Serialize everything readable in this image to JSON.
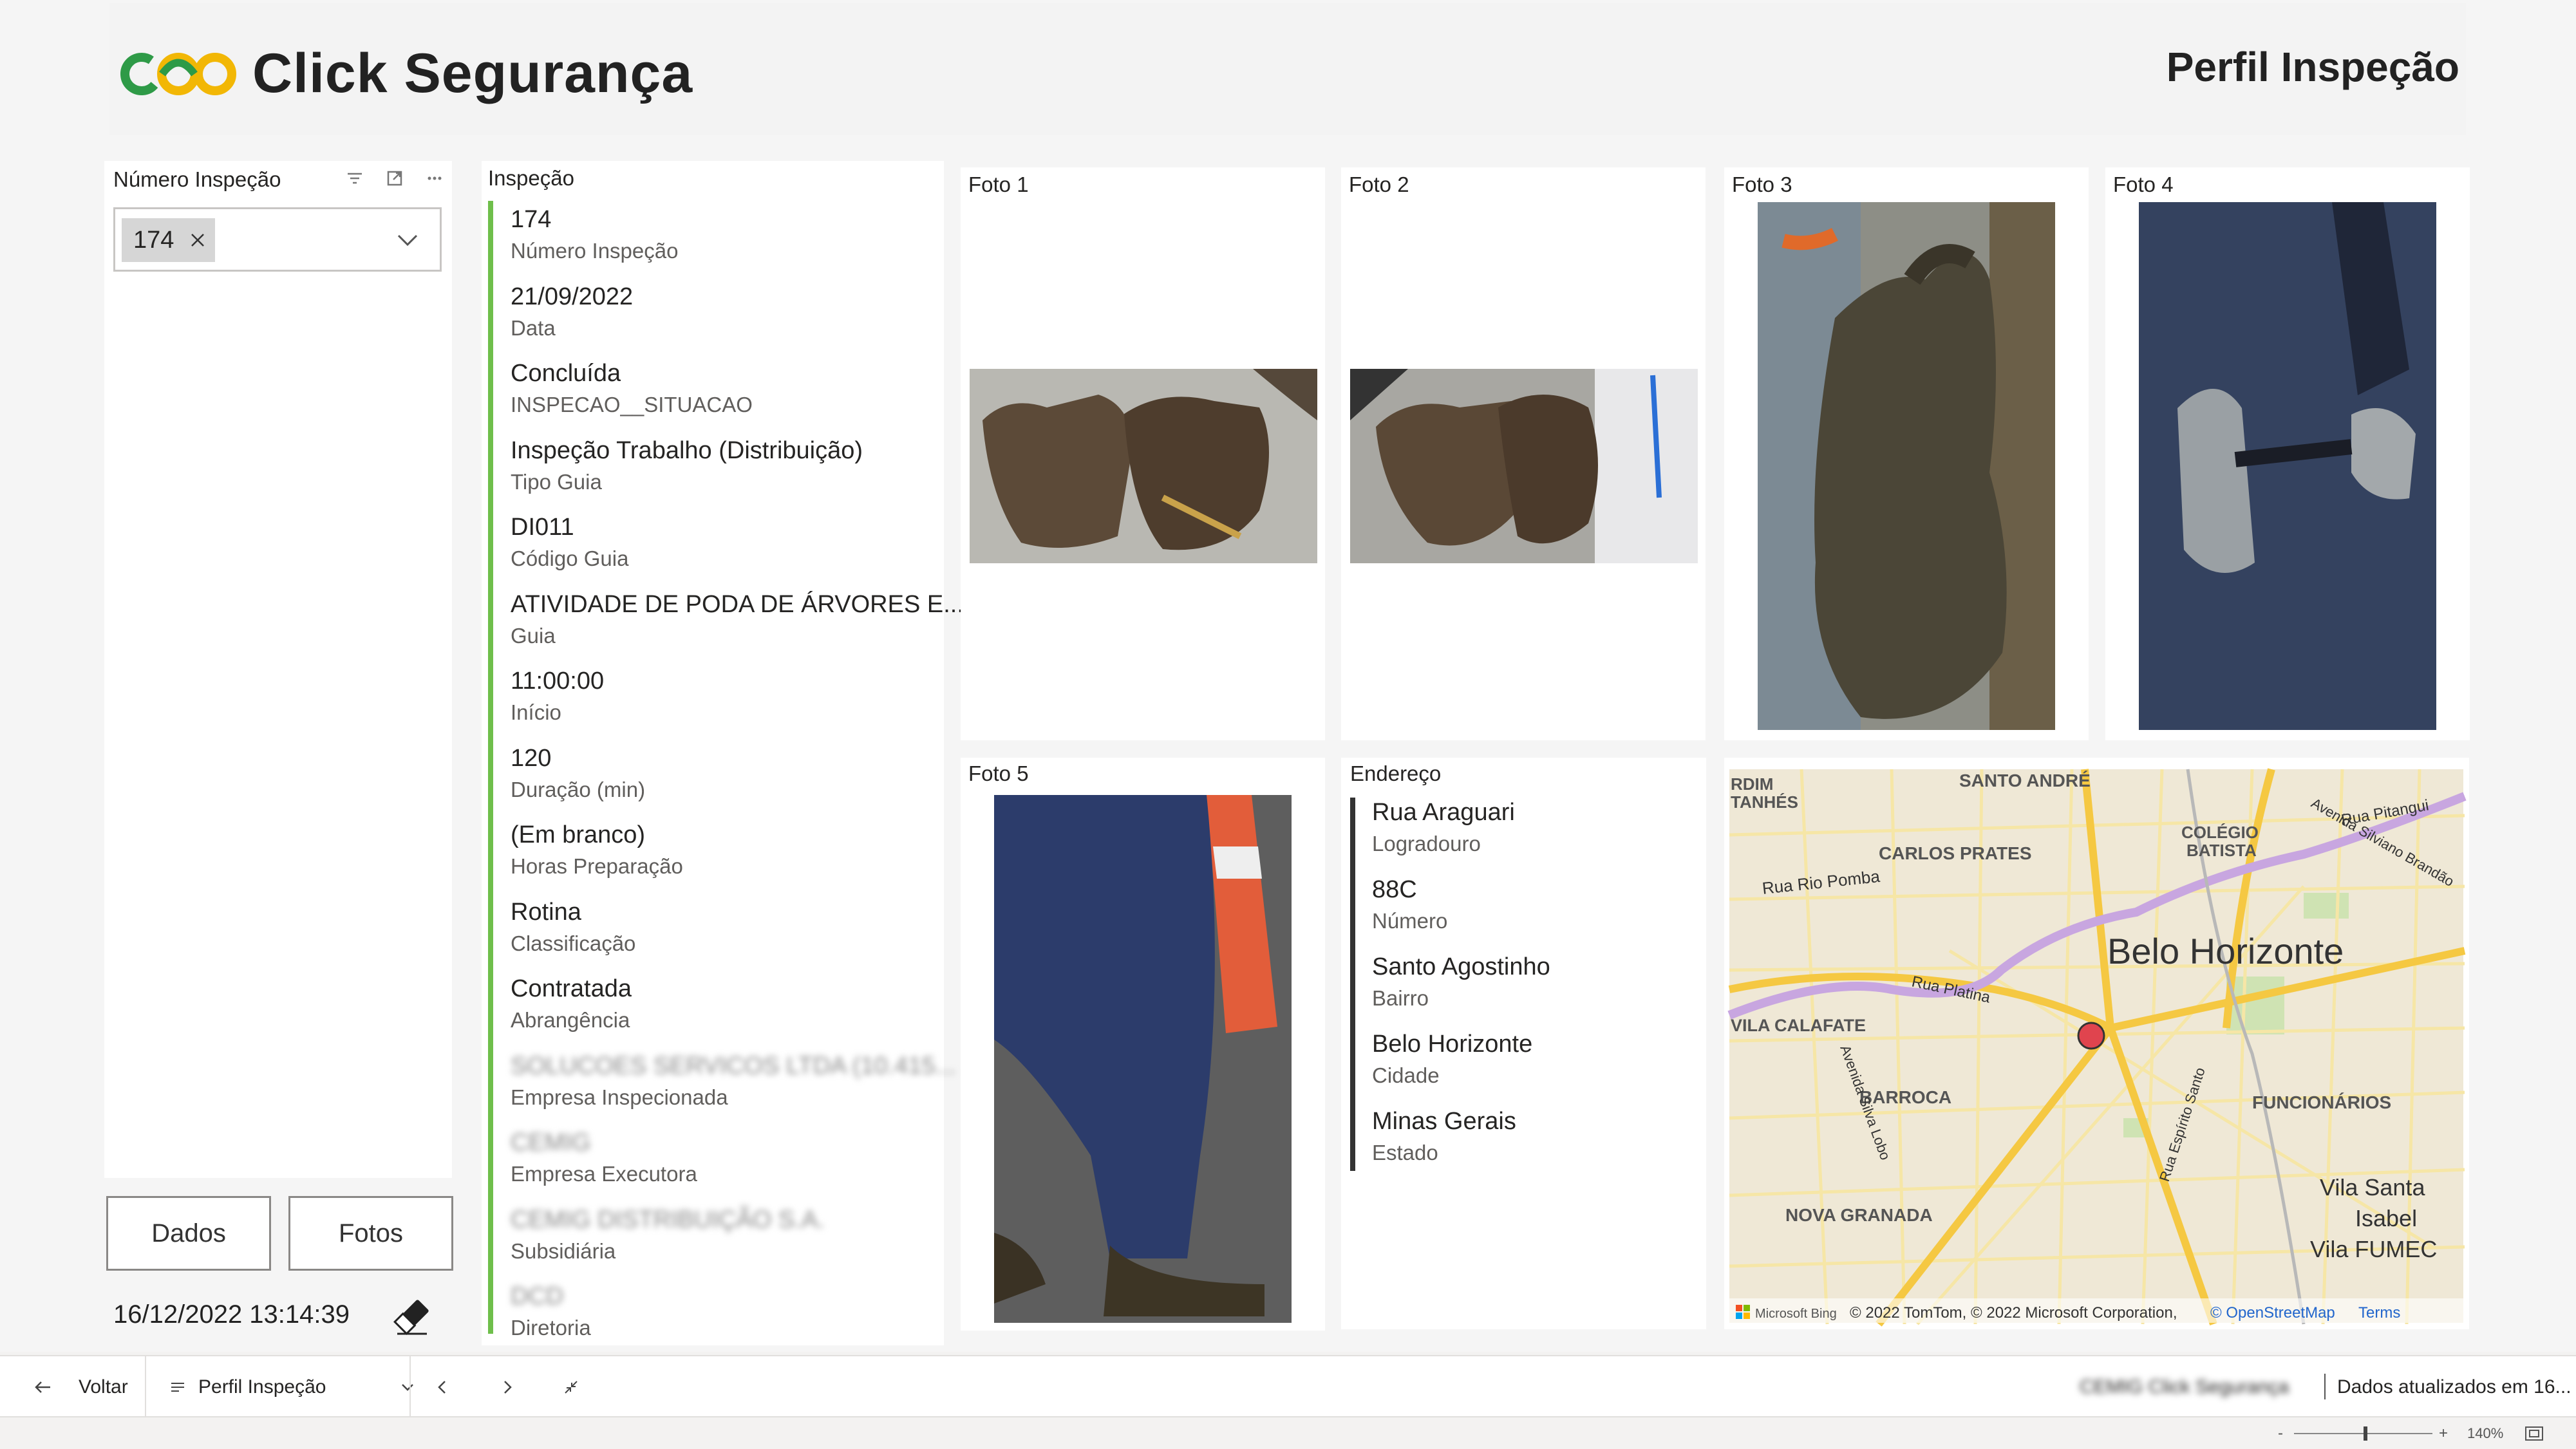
{
  "header": {
    "brand": "Click Segurança",
    "page_title": "Perfil Inspeção"
  },
  "slicer": {
    "title": "Número Inspeção",
    "selected_value": "174",
    "icons": [
      "filter-icon",
      "focus-mode-icon",
      "more-options-icon"
    ]
  },
  "buttons": {
    "dados": "Dados",
    "fotos": "Fotos"
  },
  "timestamp": "16/12/2022 13:14:39",
  "inspection": {
    "title": "Inspeção",
    "fields": [
      {
        "value": "174",
        "label": "Número Inspeção"
      },
      {
        "value": "21/09/2022",
        "label": "Data"
      },
      {
        "value": "Concluída",
        "label": "INSPECAO__SITUACAO"
      },
      {
        "value": "Inspeção Trabalho (Distribuição)",
        "label": "Tipo Guia"
      },
      {
        "value": "DI011",
        "label": "Código Guia"
      },
      {
        "value": "ATIVIDADE DE PODA DE ÁRVORES E...",
        "label": "Guia"
      },
      {
        "value": "11:00:00",
        "label": "Início"
      },
      {
        "value": "120",
        "label": "Duração (min)"
      },
      {
        "value": "(Em branco)",
        "label": "Horas Preparação"
      },
      {
        "value": "Rotina",
        "label": "Classificação"
      },
      {
        "value": "Contratada",
        "label": "Abrangência"
      },
      {
        "value": "SOLUCOES SERVICOS LTDA (10.415...",
        "label": "Empresa Inspecionada"
      },
      {
        "value": "CEMIG",
        "label": "Empresa Executora"
      },
      {
        "value": "CEMIG DISTRIBUIÇÃO S.A.",
        "label": "Subsidiária"
      },
      {
        "value": "DCD",
        "label": "Diretoria"
      }
    ]
  },
  "photos": {
    "foto1": "Foto 1",
    "foto2": "Foto 2",
    "foto3": "Foto 3",
    "foto4": "Foto 4",
    "foto5": "Foto 5"
  },
  "address": {
    "title": "Endereço",
    "fields": [
      {
        "value": "Rua Araguari",
        "label": "Logradouro"
      },
      {
        "value": "88C",
        "label": "Número"
      },
      {
        "value": "Santo Agostinho",
        "label": "Bairro"
      },
      {
        "value": "Belo Horizonte",
        "label": "Cidade"
      },
      {
        "value": "Minas Gerais",
        "label": "Estado"
      }
    ]
  },
  "map": {
    "city_label": "Belo Horizonte",
    "neighborhoods": [
      "SANTO ANDRÉ",
      "CARLOS PRATES",
      "COLÉGIO BATISTA",
      "VILA CALAFATE",
      "BARROCA",
      "FUNCIONÁRIOS",
      "NOVA GRANADA",
      "Vila Santa Isabel",
      "Vila FUMEC",
      "RDIM TANHÉS"
    ],
    "streets": [
      "Rua Rio Pomba",
      "Rua Platina",
      "Rua Pitangui",
      "Avenida Silviano Brandão",
      "Avenida Silva Lobo",
      "Rua Espírito Santo"
    ],
    "attribution_brand": "Microsoft Bing",
    "attribution": "© 2022 TomTom, © 2022 Microsoft Corporation,",
    "osm_link": "© OpenStreetMap",
    "terms_link": "Terms",
    "marker_color": "#e0444e"
  },
  "navbar": {
    "back": "Voltar",
    "page": "Perfil Inspeção",
    "workspace": "CEMIG Click Segurança",
    "data_updated": "Dados atualizados em 16..."
  },
  "statusbar": {
    "zoom": "140%"
  },
  "colors": {
    "accent_green": "#6fbf4b",
    "logo_green": "#2e9a47",
    "logo_yellow": "#f2b705"
  }
}
